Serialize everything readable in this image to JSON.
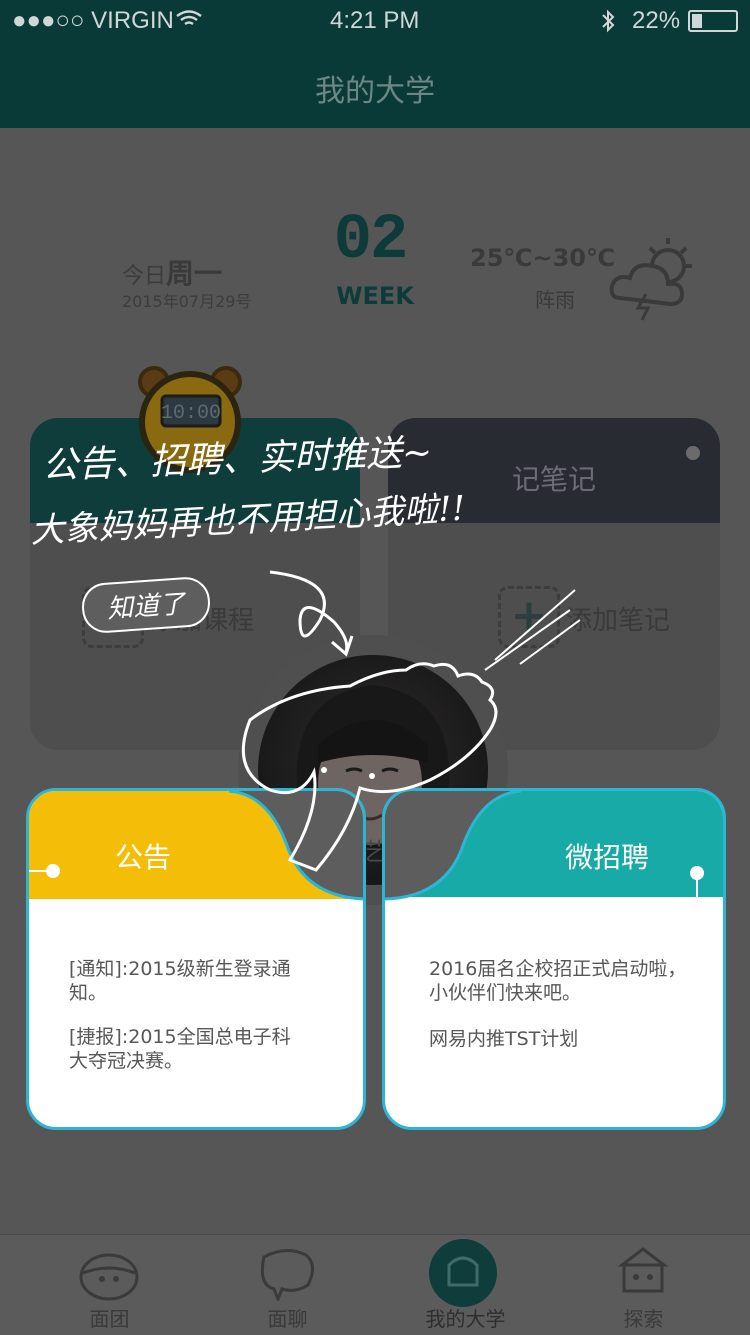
{
  "status": {
    "carrier": "●●●○○ VIRGIN",
    "time": "4:21 PM",
    "battery": "22%"
  },
  "nav": {
    "title": "我的大学"
  },
  "date": {
    "weekday_prefix": "今日",
    "weekday": "周一",
    "full": "2015年07月29号",
    "week_number": "02",
    "week_label": "WEEK",
    "temperature": "25℃~30℃",
    "weather": "阵雨",
    "clock": "10:00"
  },
  "cards": {
    "course_add": "添加课程",
    "notes_title": "记笔记",
    "notes_add": "添加笔记"
  },
  "avatar": {
    "name": "文艺猪"
  },
  "notice": {
    "title": "公告",
    "items": [
      "[通知]:2015级新生登录通知。",
      "[捷报]:2015全国总电子科大夺冠决赛。"
    ]
  },
  "recruit": {
    "title": "微招聘",
    "items": [
      "2016届名企校招正式启动啦，小伙伴们快来吧。",
      "网易内推TST计划"
    ]
  },
  "overlay": {
    "line1": "公告、招聘、实时推送~",
    "line2": "大象妈妈再也不用担心我啦!!",
    "dismiss": "知道了"
  },
  "tabs": [
    {
      "label": "面团",
      "icon": "dough-icon"
    },
    {
      "label": "面聊",
      "icon": "elephant-icon"
    },
    {
      "label": "我的大学",
      "icon": "university-icon"
    },
    {
      "label": "探索",
      "icon": "explore-icon"
    }
  ],
  "colors": {
    "notice": "#f4bd08",
    "recruit": "#17aaa7",
    "border": "#2bb6d6",
    "dim": "#5e5e5e"
  }
}
